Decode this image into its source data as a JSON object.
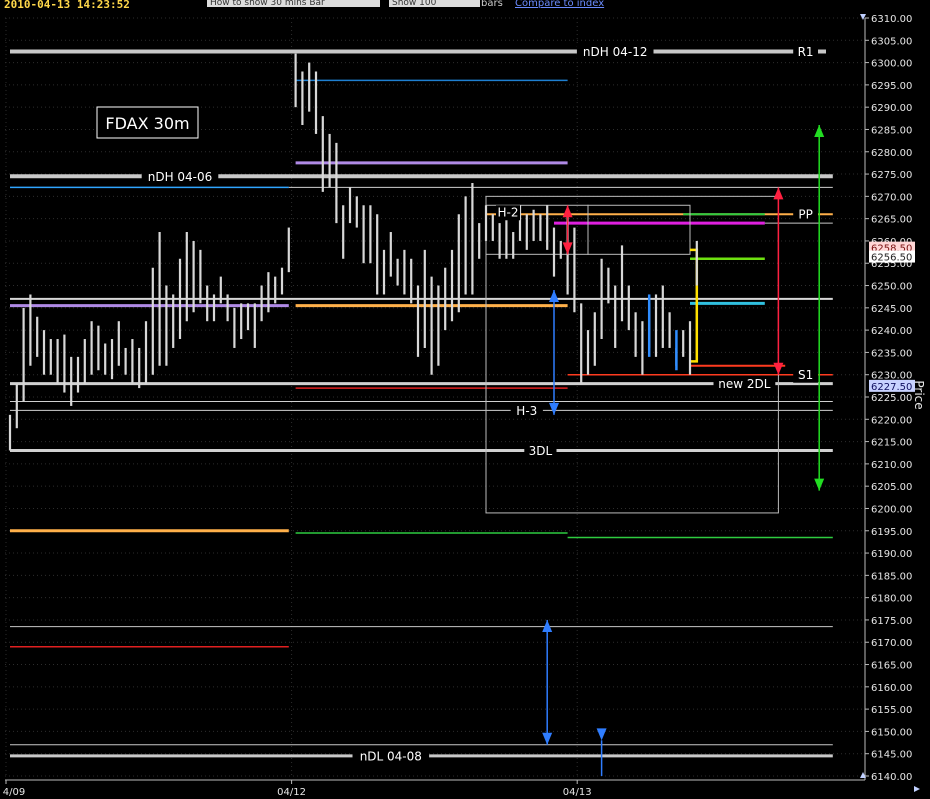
{
  "toolbar": {
    "timestamp": "2010-04-13 14:23:52",
    "how_to_show": "How to show   30 mins Bar",
    "show_label": "Show  100",
    "bars_label": "bars",
    "compare_link": "Compare to index"
  },
  "chart_data": {
    "type": "bar",
    "title": "FDAX 30m",
    "ylabel": "Price",
    "ylim": [
      6140,
      6310
    ],
    "y_ticks": [
      "6310.00",
      "6305.00",
      "6300.00",
      "6295.00",
      "6290.00",
      "6285.00",
      "6280.00",
      "6275.00",
      "6270.00",
      "6265.00",
      "6260.00",
      "6255.00",
      "6250.00",
      "6245.00",
      "6240.00",
      "6235.00",
      "6230.00",
      "6225.00",
      "6220.00",
      "6215.00",
      "6210.00",
      "6205.00",
      "6200.00",
      "6195.00",
      "6190.00",
      "6185.00",
      "6180.00",
      "6175.00",
      "6170.00",
      "6165.00",
      "6160.00",
      "6155.00",
      "6150.00",
      "6145.00",
      "6140.00"
    ],
    "x_ticks": [
      {
        "label": "4/09",
        "bar": 0
      },
      {
        "label": "04/12",
        "bar": 42
      },
      {
        "label": "04/13",
        "bar": 84
      }
    ],
    "price_tags": [
      {
        "value": 6258.5,
        "text": "6258.50",
        "bg": "#ffd6d6",
        "fg": "#7a1010"
      },
      {
        "value": 6256.5,
        "text": "6256.50",
        "bg": "#ffffff",
        "fg": "#222222"
      },
      {
        "value": 6227.5,
        "text": "6227.50",
        "bg": "#c8d2ff",
        "fg": "#101060"
      }
    ],
    "bars": [
      [
        6221,
        6213
      ],
      [
        6228,
        6218
      ],
      [
        6245,
        6224
      ],
      [
        6248,
        6232
      ],
      [
        6243,
        6234
      ],
      [
        6240,
        6230
      ],
      [
        6238,
        6230
      ],
      [
        6238,
        6228
      ],
      [
        6239,
        6226
      ],
      [
        6234,
        6223
      ],
      [
        6234,
        6226
      ],
      [
        6238,
        6228
      ],
      [
        6242,
        6230
      ],
      [
        6241,
        6231
      ],
      [
        6237,
        6230
      ],
      [
        6238,
        6229
      ],
      [
        6242,
        6232
      ],
      [
        6236,
        6230
      ],
      [
        6238,
        6228
      ],
      [
        6236,
        6227
      ],
      [
        6242,
        6228
      ],
      [
        6254,
        6230
      ],
      [
        6262,
        6232
      ],
      [
        6250,
        6232
      ],
      [
        6248,
        6236
      ],
      [
        6256,
        6238
      ],
      [
        6262,
        6242
      ],
      [
        6260,
        6244
      ],
      [
        6258,
        6246
      ],
      [
        6250,
        6242
      ],
      [
        6248,
        6242
      ],
      [
        6252,
        6246
      ],
      [
        6248,
        6242
      ],
      [
        6245,
        6236
      ],
      [
        6246,
        6238
      ],
      [
        6246,
        6240
      ],
      [
        6246,
        6236
      ],
      [
        6250,
        6242
      ],
      [
        6253,
        6244
      ],
      [
        6252,
        6246
      ],
      [
        6254,
        6248
      ],
      [
        6263,
        6253
      ],
      [
        6302,
        6290
      ],
      [
        6298,
        6286
      ],
      [
        6300,
        6289
      ],
      [
        6298,
        6284
      ],
      [
        6288,
        6271
      ],
      [
        6284,
        6272
      ],
      [
        6282,
        6264
      ],
      [
        6268,
        6256
      ],
      [
        6272,
        6264
      ],
      [
        6270,
        6263
      ],
      [
        6268,
        6255
      ],
      [
        6268,
        6255
      ],
      [
        6266,
        6248
      ],
      [
        6258,
        6248
      ],
      [
        6262,
        6252
      ],
      [
        6256,
        6250
      ],
      [
        6258,
        6248
      ],
      [
        6256,
        6246
      ],
      [
        6250,
        6234
      ],
      [
        6258,
        6236
      ],
      [
        6252,
        6230
      ],
      [
        6250,
        6232
      ],
      [
        6254,
        6240
      ],
      [
        6258,
        6242
      ],
      [
        6266,
        6244
      ],
      [
        6270,
        6248
      ],
      [
        6273,
        6248
      ],
      [
        6264,
        6256
      ],
      [
        6268,
        6260
      ],
      [
        6266,
        6260
      ],
      [
        6264,
        6256
      ],
      [
        6268,
        6256
      ],
      [
        6262,
        6256
      ],
      [
        6268,
        6260
      ],
      [
        6266,
        6258
      ],
      [
        6267,
        6260
      ],
      [
        6266,
        6260
      ],
      [
        6268,
        6258
      ],
      [
        6263,
        6252
      ],
      [
        6260,
        6256
      ],
      [
        6266,
        6248
      ],
      [
        6263,
        6244
      ],
      [
        6246,
        6228
      ],
      [
        6240,
        6230
      ],
      [
        6244,
        6232
      ],
      [
        6256,
        6238
      ],
      [
        6254,
        6246
      ],
      [
        6250,
        6236
      ],
      [
        6259,
        6242
      ],
      [
        6250,
        6240
      ],
      [
        6244,
        6234
      ],
      [
        6242,
        6230
      ],
      [
        6246,
        6236
      ],
      [
        6248,
        6234
      ],
      [
        6250,
        6236
      ],
      [
        6244,
        6236
      ],
      [
        6236,
        6232
      ],
      [
        6240,
        6234
      ],
      [
        6242,
        6230
      ],
      [
        6260,
        6250
      ]
    ],
    "blue_bars": [
      {
        "bar": 94,
        "high": 6248,
        "low": 6234
      },
      {
        "bar": 98,
        "high": 6240,
        "low": 6231
      }
    ],
    "levels": [
      {
        "value": 6302.5,
        "from": 0,
        "to": 120,
        "color": "#c8c8c8",
        "width": 4,
        "label": "nDH 04-12",
        "label_at": 89
      },
      {
        "value": 6302.5,
        "from": 114,
        "to": 120,
        "color": "#c8c8c8",
        "width": 4,
        "label": "R1",
        "label_at": 117
      },
      {
        "value": 6296,
        "from": 42,
        "to": 82,
        "color": "#1e7fd0",
        "width": 1.5
      },
      {
        "value": 6277.5,
        "from": 42,
        "to": 82,
        "color": "#b08ae6",
        "width": 3
      },
      {
        "value": 6274.5,
        "from": 0,
        "to": 121,
        "color": "#c8c8c8",
        "width": 4,
        "label": "nDH 04-06",
        "label_at": 25
      },
      {
        "value": 6272,
        "from": 0,
        "to": 41,
        "color": "#2fa5ff",
        "width": 1.5
      },
      {
        "value": 6272,
        "from": 41,
        "to": 121,
        "color": "#d0d0d0",
        "width": 1
      },
      {
        "value": 6266,
        "from": 70,
        "to": 121,
        "color": "#ffb04a",
        "width": 2,
        "label": "PP",
        "label_at": 117
      },
      {
        "value": 6266,
        "from": 99,
        "to": 111,
        "color": "#2ecc40",
        "width": 2
      },
      {
        "value": 6264,
        "from": 80,
        "to": 111,
        "color": "#e020e0",
        "width": 3
      },
      {
        "value": 6264,
        "from": 111,
        "to": 121,
        "color": "#c8c8c8",
        "width": 1
      },
      {
        "value": 6256,
        "from": 100,
        "to": 111,
        "color": "#6ee010",
        "width": 2.5
      },
      {
        "value": 6247,
        "from": 0,
        "to": 121,
        "color": "#d8d8d8",
        "width": 2
      },
      {
        "value": 6246,
        "from": 100,
        "to": 111,
        "color": "#30c0e0",
        "width": 3
      },
      {
        "value": 6245.5,
        "from": 0,
        "to": 41,
        "color": "#b08ae6",
        "width": 3
      },
      {
        "value": 6245.5,
        "from": 42,
        "to": 82,
        "color": "#ffb04a",
        "width": 3
      },
      {
        "value": 6232,
        "from": 100,
        "to": 114,
        "color": "#ff3b1f",
        "width": 2
      },
      {
        "value": 6230,
        "from": 82,
        "to": 121,
        "color": "#ff3b1f",
        "width": 1.5,
        "label": "S1",
        "label_at": 117
      },
      {
        "value": 6228,
        "from": 0,
        "to": 121,
        "color": "#d0d0d0",
        "width": 3,
        "label": "new 2DL",
        "label_at": 108
      },
      {
        "value": 6227,
        "from": 42,
        "to": 82,
        "color": "#e02020",
        "width": 1.5
      },
      {
        "value": 6224,
        "from": 0,
        "to": 121,
        "color": "#d0d0d0",
        "width": 1
      },
      {
        "value": 6222,
        "from": 0,
        "to": 121,
        "color": "#d0d0d0",
        "width": 1,
        "label": "H-3",
        "label_at": 76
      },
      {
        "value": 6213,
        "from": 0,
        "to": 121,
        "color": "#d0d0d0",
        "width": 3,
        "label": "3DL",
        "label_at": 78
      },
      {
        "value": 6195,
        "from": 0,
        "to": 41,
        "color": "#ffb04a",
        "width": 3
      },
      {
        "value": 6194.5,
        "from": 42,
        "to": 82,
        "color": "#2ecc40",
        "width": 1.5
      },
      {
        "value": 6193.5,
        "from": 82,
        "to": 121,
        "color": "#2ecc40",
        "width": 1.5
      },
      {
        "value": 6173.5,
        "from": 0,
        "to": 121,
        "color": "#c8c8c8",
        "width": 1
      },
      {
        "value": 6169,
        "from": 0,
        "to": 41,
        "color": "#e02020",
        "width": 1.5
      },
      {
        "value": 6147,
        "from": 0,
        "to": 121,
        "color": "#c8c8c8",
        "width": 1
      },
      {
        "value": 6144.5,
        "from": 0,
        "to": 121,
        "color": "#c8c8c8",
        "width": 3,
        "label": "nDL 04-08",
        "label_at": 56
      }
    ],
    "boxes": [
      {
        "from": 70,
        "to": 113,
        "top": 6270,
        "bottom": 6199,
        "color": "#bbbbbb"
      },
      {
        "from": 70,
        "to": 85,
        "top": 6268,
        "bottom": 6257,
        "color": "#bbbbbb",
        "label": "H-2"
      },
      {
        "from": 85,
        "to": 100,
        "top": 6268,
        "bottom": 6257,
        "color": "#bbbbbb"
      }
    ],
    "arrows": [
      {
        "bar": 82,
        "from": 6268,
        "to": 6257,
        "color": "#ff2040",
        "double": true
      },
      {
        "bar": 113,
        "from": 6272,
        "to": 6230,
        "color": "#ff2040",
        "double": true
      },
      {
        "bar": 119,
        "from": 6286,
        "to": 6204,
        "color": "#22dd22",
        "double": true
      },
      {
        "bar": 80,
        "from": 6249,
        "to": 6221,
        "color": "#2f7dff",
        "double": true
      },
      {
        "bar": 79,
        "from": 6175,
        "to": 6147,
        "color": "#2f7dff",
        "double": true
      },
      {
        "bar": 87,
        "from": 6140,
        "to": 6148,
        "color": "#2f7dff",
        "double": false
      }
    ],
    "yellow_bracket": {
      "from": 100,
      "to": 101,
      "top": 6258,
      "bottom": 6233,
      "color": "#ffe000"
    }
  }
}
